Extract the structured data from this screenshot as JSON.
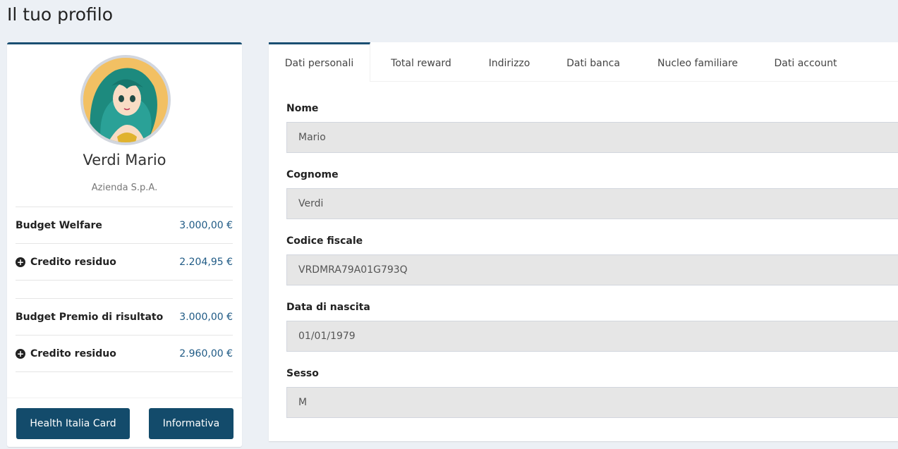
{
  "page_title": "Il tuo profilo",
  "profile": {
    "name": "Verdi Mario",
    "company": "Azienda S.p.A."
  },
  "budgets": [
    {
      "label": "Budget Welfare",
      "value": "3.000,00 €",
      "icon": ""
    },
    {
      "label": "Credito residuo",
      "value": "2.204,95 €",
      "icon": "plus-circle-icon"
    },
    {
      "label": "Budget Premio di risultato",
      "value": "3.000,00 €",
      "icon": ""
    },
    {
      "label": "Credito residuo",
      "value": "2.960,00 €",
      "icon": "plus-circle-icon"
    }
  ],
  "buttons": {
    "card": "Health Italia Card",
    "info": "Informativa"
  },
  "tabs": [
    {
      "label": "Dati personali",
      "active": true
    },
    {
      "label": "Total reward",
      "active": false
    },
    {
      "label": "Indirizzo",
      "active": false
    },
    {
      "label": "Dati banca",
      "active": false
    },
    {
      "label": "Nucleo familiare",
      "active": false
    },
    {
      "label": "Dati account",
      "active": false
    }
  ],
  "fields": [
    {
      "label": "Nome",
      "value": "Mario"
    },
    {
      "label": "Cognome",
      "value": "Verdi"
    },
    {
      "label": "Codice fiscale",
      "value": "VRDMRA79A01G793Q"
    },
    {
      "label": "Data di nascita",
      "value": "01/01/1979"
    },
    {
      "label": "Sesso",
      "value": "M"
    }
  ],
  "colors": {
    "accent": "#1b4f72",
    "button": "#134b6b",
    "value_text": "#1f5a85",
    "background": "#ecf0f5"
  }
}
